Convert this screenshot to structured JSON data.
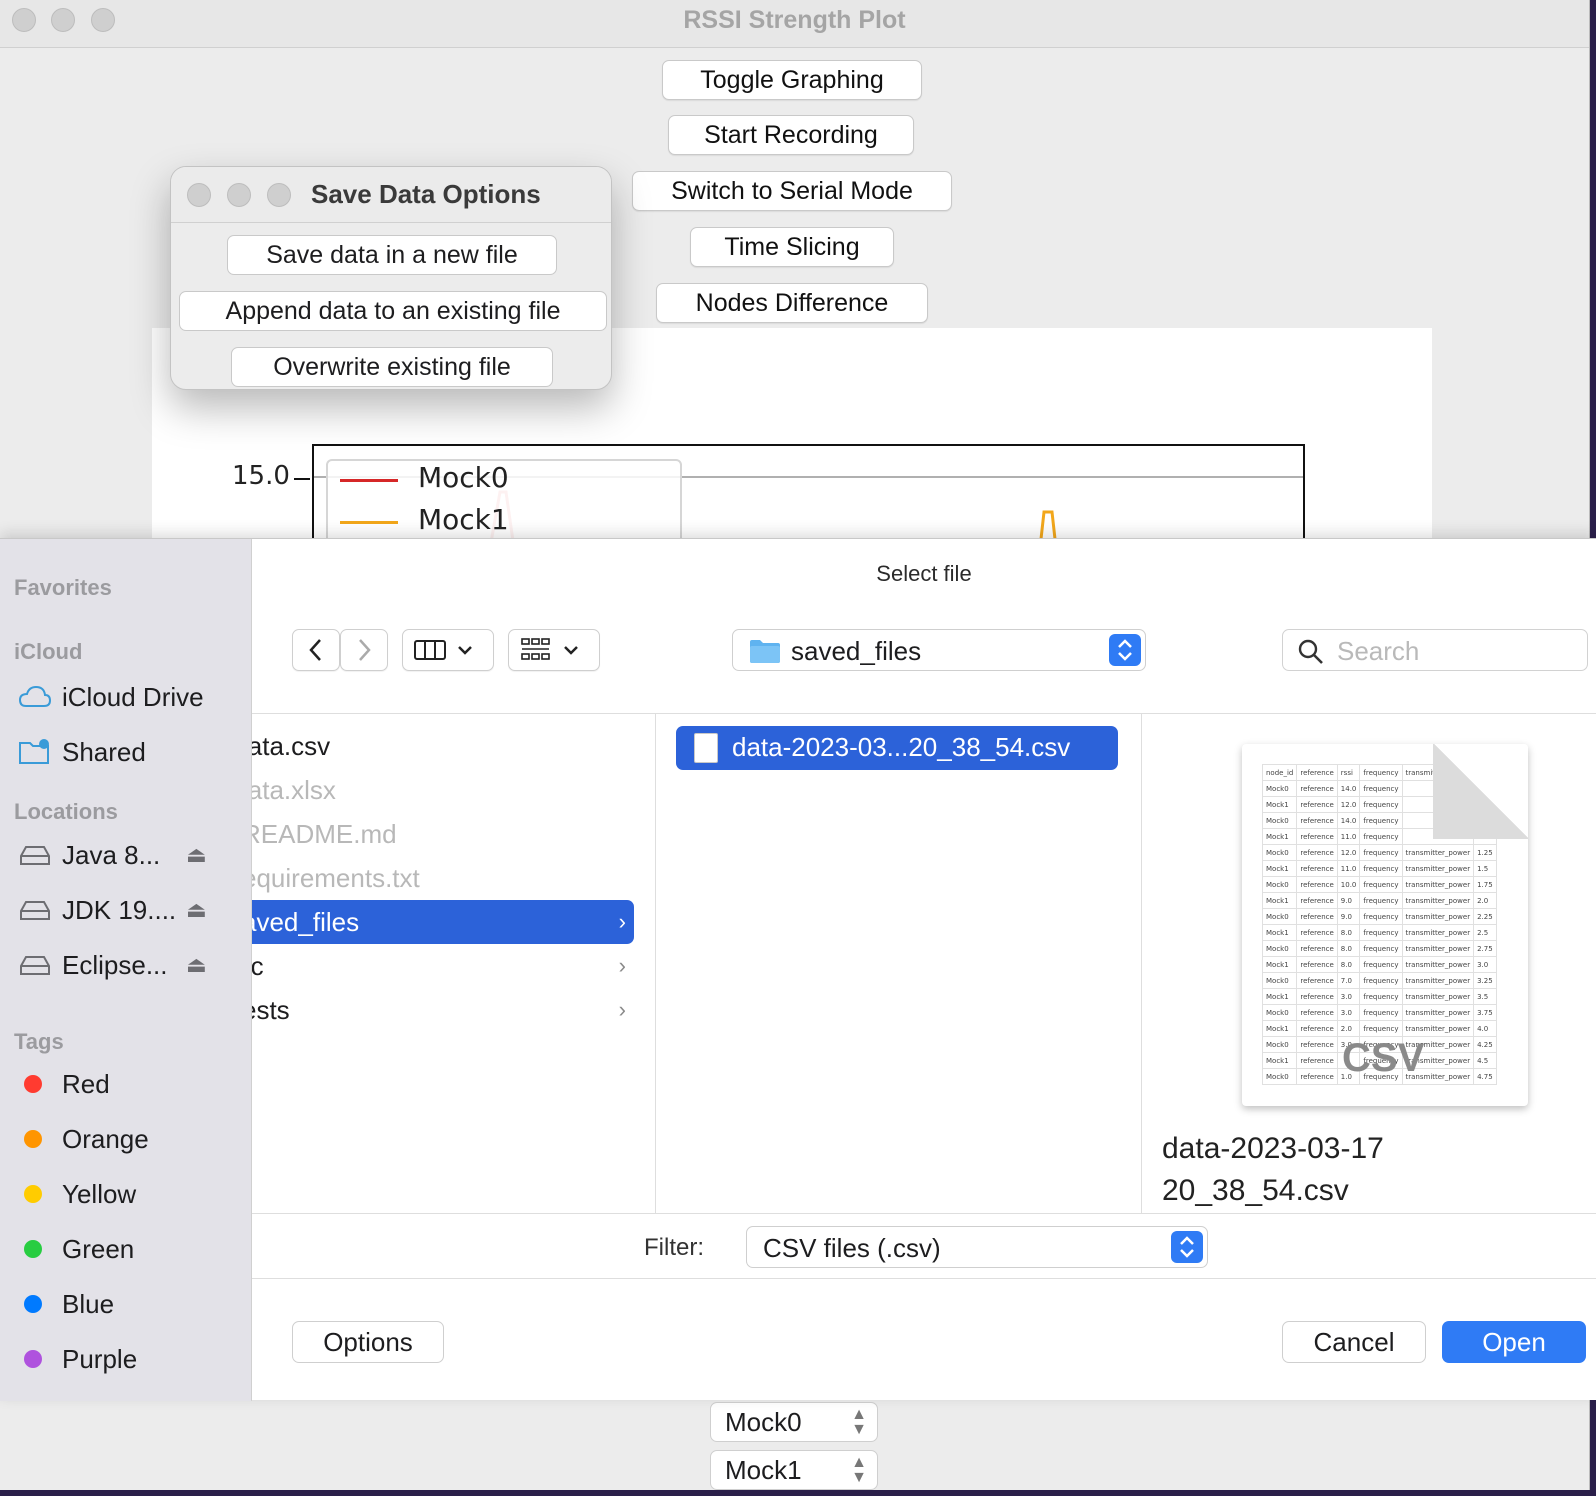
{
  "window": {
    "title": "RSSI Strength Plot"
  },
  "controls": {
    "toggle_graphing": "Toggle Graphing",
    "start_recording": "Start Recording",
    "switch_serial": "Switch to Serial Mode",
    "time_slicing": "Time Slicing",
    "nodes_difference": "Nodes Difference"
  },
  "plot": {
    "ytick": "15.0",
    "legend": [
      {
        "label": "Mock0",
        "color": "#d62728"
      },
      {
        "label": "Mock1",
        "color": "#f2a71b"
      }
    ]
  },
  "popup": {
    "title": "Save Data Options",
    "save_new": "Save data in a new file",
    "append": "Append data to an existing file",
    "overwrite": "Overwrite existing file"
  },
  "dialog": {
    "title": "Select file",
    "path": "saved_files",
    "search_placeholder": "Search",
    "sidebar": {
      "favorites": "Favorites",
      "icloud": "iCloud",
      "icloud_drive": "iCloud Drive",
      "shared": "Shared",
      "locations": "Locations",
      "loc_items": [
        "Java 8...",
        "JDK 19....",
        "Eclipse..."
      ],
      "tags": "Tags",
      "tag_items": [
        {
          "label": "Red",
          "color": "#ff3b30"
        },
        {
          "label": "Orange",
          "color": "#ff9500"
        },
        {
          "label": "Yellow",
          "color": "#ffcc00"
        },
        {
          "label": "Green",
          "color": "#28cd41"
        },
        {
          "label": "Blue",
          "color": "#007aff"
        },
        {
          "label": "Purple",
          "color": "#af52de"
        }
      ]
    },
    "column1": [
      "lata.csv",
      "lata.xlsx",
      "README.md",
      "equirements.txt",
      "aved_files",
      "rc",
      "ests"
    ],
    "selected_file": "data-2023-03...20_38_54.csv",
    "preview": {
      "badge": "CSV",
      "name_line1": "data-2023-03-17",
      "name_line2": "20_38_54.csv",
      "header": [
        "node_id",
        "reference",
        "rssi",
        "frequency",
        "transmitter_power",
        ""
      ],
      "rows": [
        [
          "Mock0",
          "reference",
          "14.0",
          "frequency",
          "",
          ""
        ],
        [
          "Mock1",
          "reference",
          "12.0",
          "frequency",
          "",
          ""
        ],
        [
          "Mock0",
          "reference",
          "14.0",
          "frequency",
          "",
          ""
        ],
        [
          "Mock1",
          "reference",
          "11.0",
          "frequency",
          "",
          ""
        ],
        [
          "Mock0",
          "reference",
          "12.0",
          "frequency",
          "transmitter_power",
          "1.25"
        ],
        [
          "Mock1",
          "reference",
          "11.0",
          "frequency",
          "transmitter_power",
          "1.5"
        ],
        [
          "Mock0",
          "reference",
          "10.0",
          "frequency",
          "transmitter_power",
          "1.75"
        ],
        [
          "Mock1",
          "reference",
          "9.0",
          "frequency",
          "transmitter_power",
          "2.0"
        ],
        [
          "Mock0",
          "reference",
          "9.0",
          "frequency",
          "transmitter_power",
          "2.25"
        ],
        [
          "Mock1",
          "reference",
          "8.0",
          "frequency",
          "transmitter_power",
          "2.5"
        ],
        [
          "Mock0",
          "reference",
          "8.0",
          "frequency",
          "transmitter_power",
          "2.75"
        ],
        [
          "Mock1",
          "reference",
          "8.0",
          "frequency",
          "transmitter_power",
          "3.0"
        ],
        [
          "Mock0",
          "reference",
          "7.0",
          "frequency",
          "transmitter_power",
          "3.25"
        ],
        [
          "Mock1",
          "reference",
          "3.0",
          "frequency",
          "transmitter_power",
          "3.5"
        ],
        [
          "Mock0",
          "reference",
          "3.0",
          "frequency",
          "transmitter_power",
          "3.75"
        ],
        [
          "Mock1",
          "reference",
          "2.0",
          "frequency",
          "transmitter_power",
          "4.0"
        ],
        [
          "Mock0",
          "reference",
          "3.0",
          "frequency",
          "transmitter_power",
          "4.25"
        ],
        [
          "Mock1",
          "reference",
          "",
          "frequency",
          "transmitter_power",
          "4.5"
        ],
        [
          "Mock0",
          "reference",
          "1.0",
          "frequency",
          "transmitter_power",
          "4.75"
        ]
      ]
    },
    "filter_label": "Filter:",
    "filter_value": "CSV files (.csv)",
    "options": "Options",
    "cancel": "Cancel",
    "open": "Open"
  },
  "bottom": {
    "select1": "Mock0",
    "select2": "Mock1"
  }
}
